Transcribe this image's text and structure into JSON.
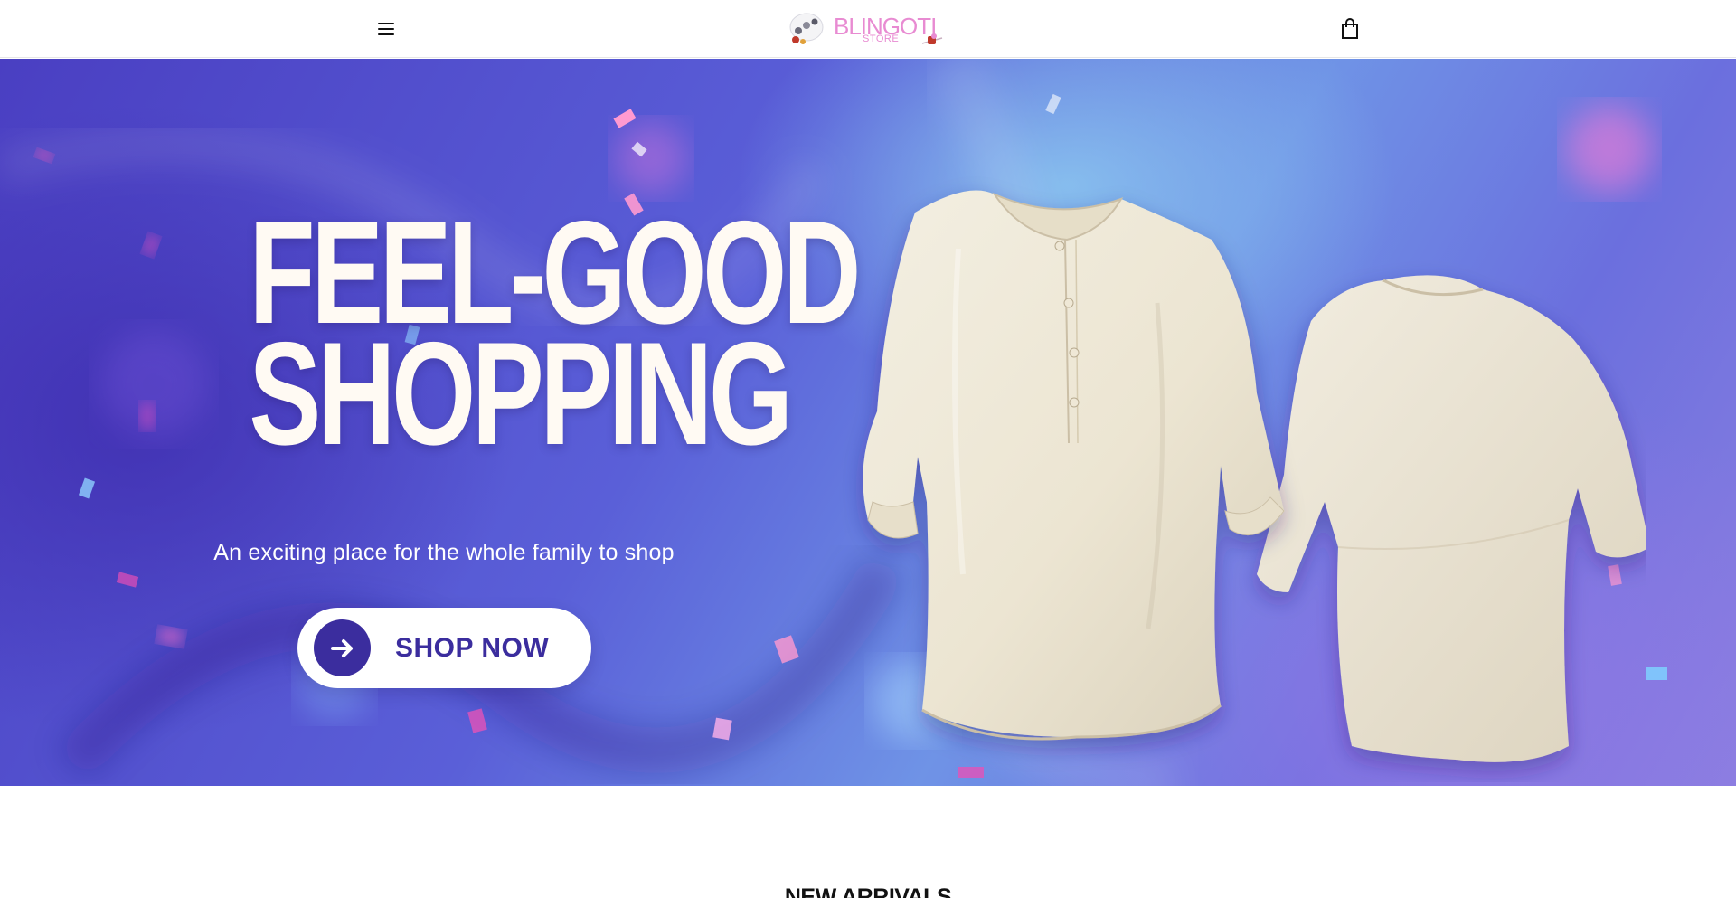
{
  "header": {
    "menu_icon": "hamburger-menu-icon",
    "logo": {
      "title": "BLINGOTI",
      "subtitle": "STORE"
    },
    "cart_icon": "shopping-bag-icon"
  },
  "hero": {
    "headline_line1": "FEEL-GOOD",
    "headline_line2": "SHOPPING",
    "tagline": "An exciting place for the whole family to shop",
    "cta_label": "SHOP NOW",
    "cta_icon": "arrow-right-icon",
    "image": "two-cream-linen-shirts",
    "colors": {
      "accent": "#3b2d9e",
      "headline": "#fffaf3",
      "background": "#5a5fd8"
    }
  },
  "sections": {
    "new_arrivals_title": "NEW ARRIVALS"
  }
}
